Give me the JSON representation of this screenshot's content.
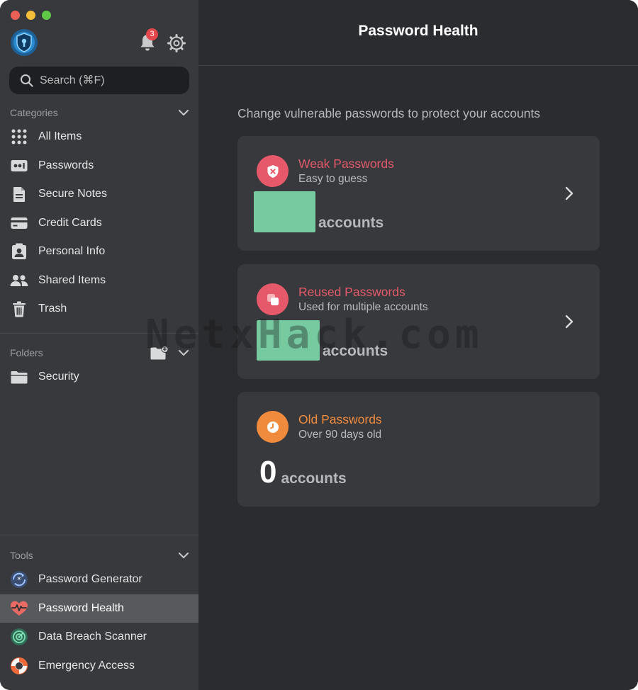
{
  "sidebar": {
    "notification_count": "3",
    "search": {
      "placeholder": "Search (⌘F)"
    },
    "categories": {
      "header": "Categories",
      "items": [
        {
          "label": "All Items",
          "icon": "grid-icon"
        },
        {
          "label": "Passwords",
          "icon": "password-icon"
        },
        {
          "label": "Secure Notes",
          "icon": "note-icon"
        },
        {
          "label": "Credit Cards",
          "icon": "credit-card-icon"
        },
        {
          "label": "Personal Info",
          "icon": "contact-card-icon"
        },
        {
          "label": "Shared Items",
          "icon": "people-icon"
        },
        {
          "label": "Trash",
          "icon": "trash-icon"
        }
      ]
    },
    "folders": {
      "header": "Folders",
      "items": [
        {
          "label": "Security",
          "icon": "folder-icon"
        }
      ]
    },
    "tools": {
      "header": "Tools",
      "items": [
        {
          "label": "Password Generator",
          "icon": "generator-icon"
        },
        {
          "label": "Password Health",
          "icon": "heart-pulse-icon",
          "active": true
        },
        {
          "label": "Data Breach Scanner",
          "icon": "radar-icon"
        },
        {
          "label": "Emergency Access",
          "icon": "lifebuoy-icon"
        }
      ]
    }
  },
  "main": {
    "title": "Password Health",
    "intro": "Change vulnerable passwords to protect your accounts",
    "cards": [
      {
        "title": "Weak Passwords",
        "subtitle": "Easy to guess",
        "count_label": "accounts",
        "accent": "#e5596a"
      },
      {
        "title": "Reused Passwords",
        "subtitle": "Used for multiple accounts",
        "count_label": "accounts",
        "accent": "#e5596a"
      },
      {
        "title": "Old Passwords",
        "subtitle": "Over 90 days old",
        "count": "0",
        "count_label": "accounts",
        "accent": "#f08a3c"
      }
    ]
  },
  "watermark": "NetxHack.com",
  "colors": {
    "accent_red": "#e5596a",
    "accent_orange": "#f08a3c",
    "redaction_green": "#77c9a0"
  }
}
